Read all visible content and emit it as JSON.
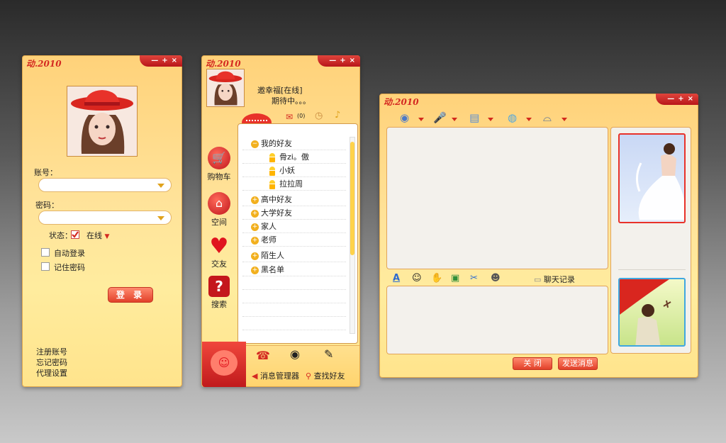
{
  "brand": "动.2010",
  "window_controls": {
    "minimize": "—",
    "maximize": "+",
    "close": "×"
  },
  "colors": {
    "accent": "#d42a22",
    "panel": "#ffe39a",
    "border": "#e2a94e",
    "scroll_thumb": "#ffd24a"
  },
  "login": {
    "account_label": "账号：",
    "account_value": "",
    "password_label": "密码：",
    "password_value": "",
    "status_label": "状态：",
    "status_value": "在线",
    "auto_login": "自动登录",
    "remember_password": "记住密码",
    "login_button": "登 录",
    "links": [
      "注册账号",
      "忘记密码",
      "代理设置"
    ]
  },
  "contacts": {
    "user_line1": "邀幸福[在线]",
    "user_line2": "期待中。。。",
    "mail_count": "(0)",
    "sidebar": [
      "购物车",
      "空间",
      "交友",
      "搜索"
    ],
    "groups_top": "我的好友",
    "friends": [
      "骨zi。傲",
      "小妖",
      "拉拉周"
    ],
    "groups": [
      "高中好友",
      "大学好友",
      "家人",
      "老师",
      "陌生人",
      "黑名单"
    ],
    "bottom_actions": [
      "消息管理器",
      "查找好友"
    ]
  },
  "chat": {
    "history_label": "聊天记录",
    "close_button": "关 闭",
    "send_button": "发送消息",
    "toolbar_icons": [
      "webcam-icon",
      "microphone-icon",
      "folder-icon",
      "chat-bubble-icon",
      "captain-hat-icon"
    ],
    "format_icons": [
      "font-icon",
      "emoji-icon",
      "hand-icon",
      "image-icon",
      "scissors-icon",
      "person-icon"
    ]
  }
}
